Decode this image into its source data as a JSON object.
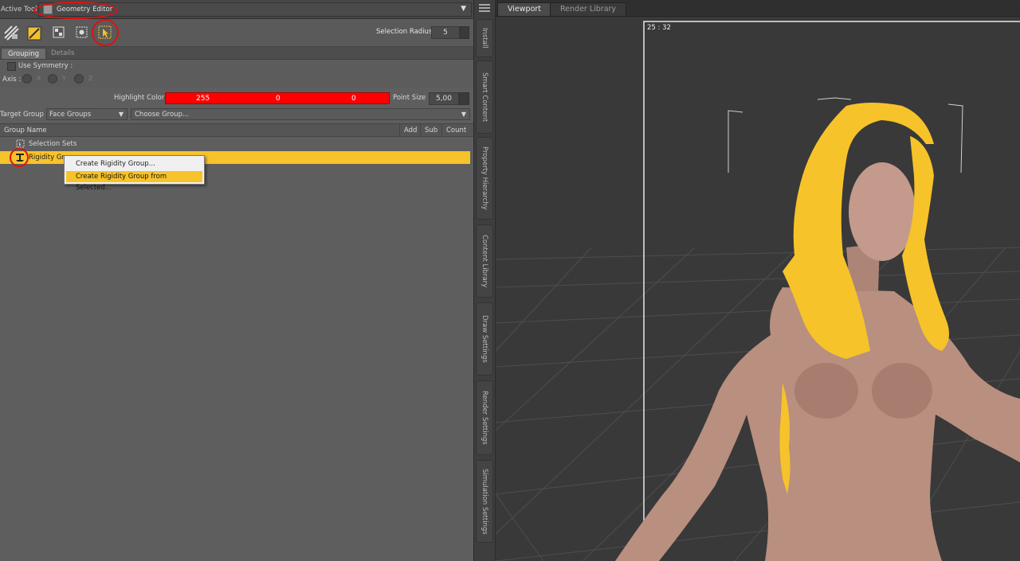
{
  "active_tool": {
    "label": "Active Tool :",
    "value": "Geometry Editor",
    "dropdown_icon": "chevron-down-icon"
  },
  "toolbar": {
    "tools": [
      "node-weight-brush-icon",
      "geometry-editor-icon",
      "region-nav-icon",
      "spot-render-icon",
      "selection-tool-icon"
    ],
    "selection_radius_label": "Selection Radius :",
    "selection_radius_value": "5"
  },
  "tabs": {
    "grouping": "Grouping",
    "details": "Details"
  },
  "symmetry": {
    "use_symmetry_label": "Use Symmetry :",
    "axis_label": "Axis :",
    "axes": [
      "X",
      "Y",
      "Z"
    ]
  },
  "highlight": {
    "label": "Highlight Color :",
    "r": "255",
    "g": "0",
    "b": "0",
    "color": "#ff0000",
    "point_size_label": "Point Size :",
    "point_size_value": "5,00"
  },
  "target": {
    "label": "Target Group :",
    "value": "Face Groups",
    "choose": "Choose Group..."
  },
  "table": {
    "columns": [
      "Group Name",
      "Add",
      "Sub",
      "Count"
    ],
    "rows": [
      {
        "label": "Selection Sets",
        "icon": "selection-sets-icon"
      },
      {
        "label": "Rigidity Groups",
        "icon": "rigidity-group-icon"
      }
    ]
  },
  "context_menu": {
    "items": [
      "Create Rigidity Group...",
      "Create Rigidity Group from Selected..."
    ]
  },
  "side_tabs": [
    "Install",
    "Smart Content",
    "Property Hierarchy",
    "Content Library",
    "Draw Settings",
    "Render Settings",
    "Simulation Settings"
  ],
  "viewport": {
    "tabs": [
      "Viewport",
      "Render Library"
    ],
    "aspect": "25 : 32"
  },
  "colors": {
    "accent": "#f6c32a",
    "panel": "#5e5e5e",
    "highlight": "#ff0000",
    "annotation": "#e01010"
  }
}
